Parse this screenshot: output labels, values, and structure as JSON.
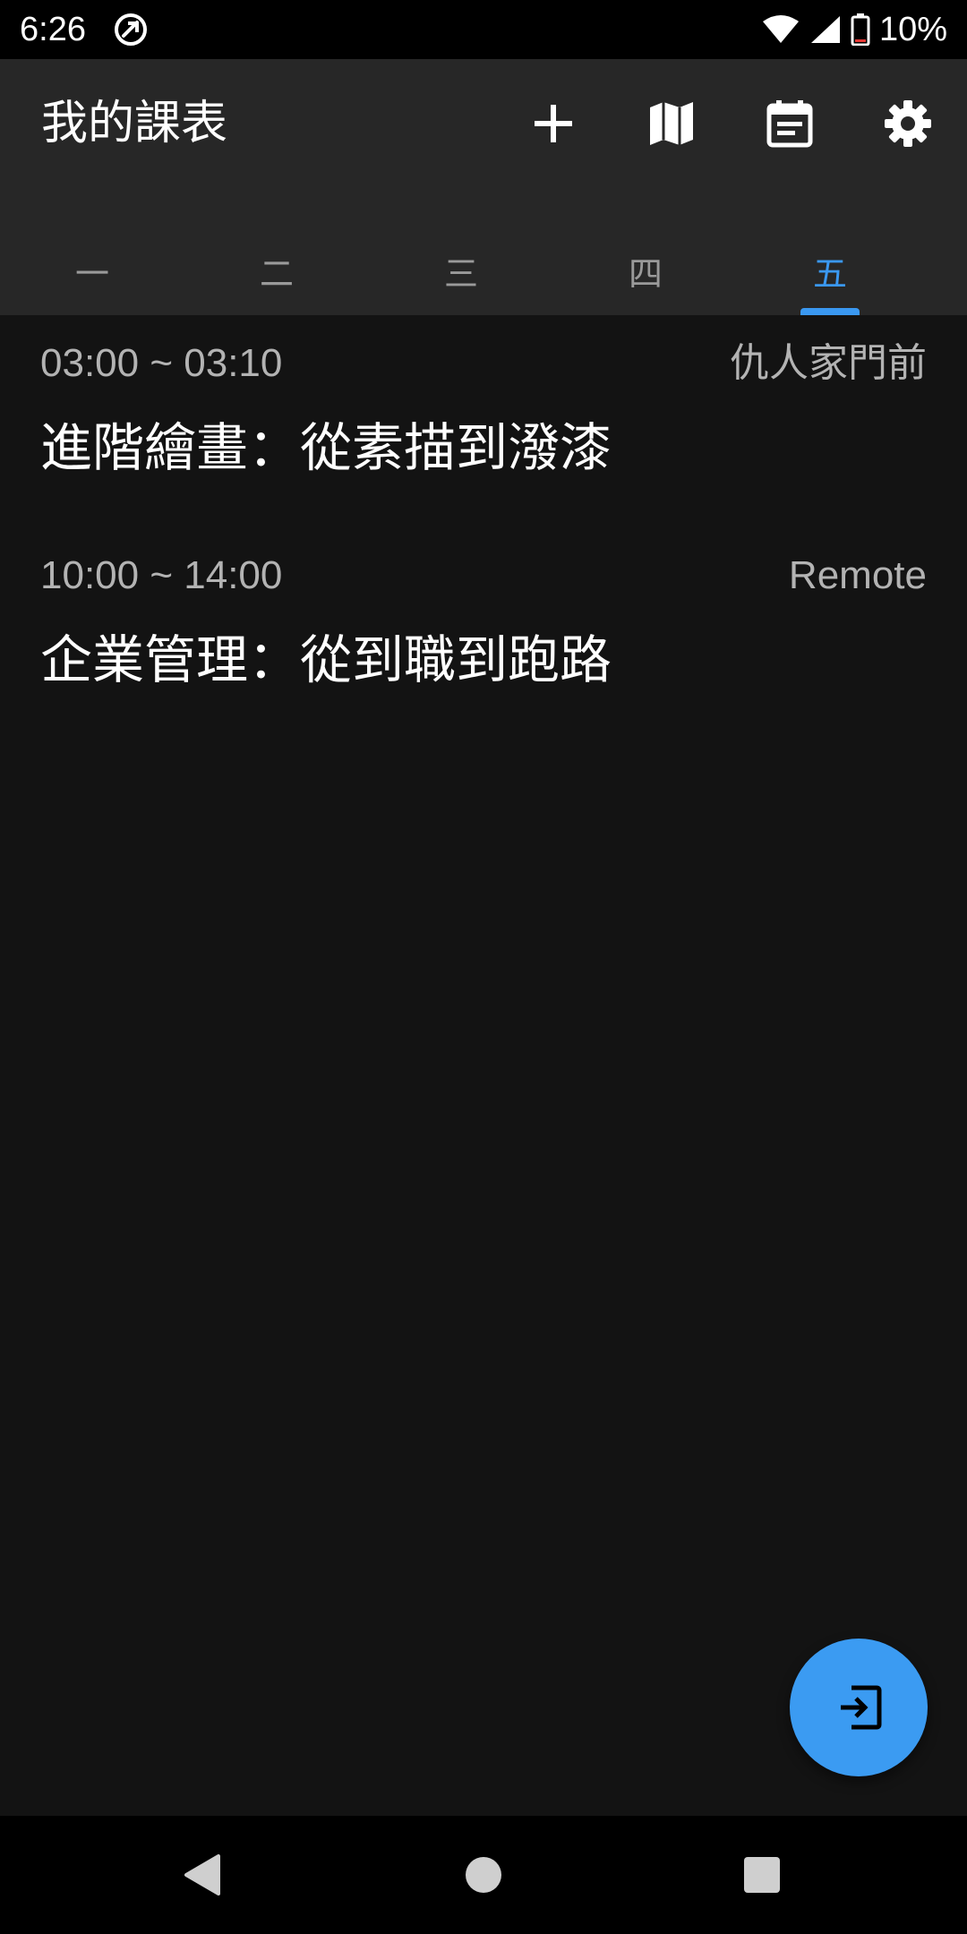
{
  "status_bar": {
    "time": "6:26",
    "battery_text": "10%",
    "icons": [
      "app-notification-icon",
      "wifi-icon",
      "signal-icon",
      "battery-icon"
    ]
  },
  "app_bar": {
    "title": "我的課表",
    "actions": [
      "add-icon",
      "map-icon",
      "calendar-icon",
      "settings-icon"
    ]
  },
  "tabs": [
    {
      "label": "一",
      "active": false
    },
    {
      "label": "二",
      "active": false
    },
    {
      "label": "三",
      "active": false
    },
    {
      "label": "四",
      "active": false
    },
    {
      "label": "五",
      "active": true
    }
  ],
  "courses": [
    {
      "time": "03:00 ~ 03:10",
      "location": "仇人家門前",
      "name": "進階繪畫：從素描到潑漆"
    },
    {
      "time": "10:00 ~ 14:00",
      "location": "Remote",
      "name": "企業管理：從到職到跑路"
    }
  ],
  "fab": {
    "icon": "exit-to-app-icon"
  },
  "nav_bar": {
    "buttons": [
      "back-icon",
      "home-icon",
      "recents-icon"
    ]
  },
  "colors": {
    "accent": "#3a98f1",
    "background": "#131313",
    "app_bar": "#272727",
    "status_bar": "#000000",
    "secondary_text": "#b3b3b3"
  }
}
